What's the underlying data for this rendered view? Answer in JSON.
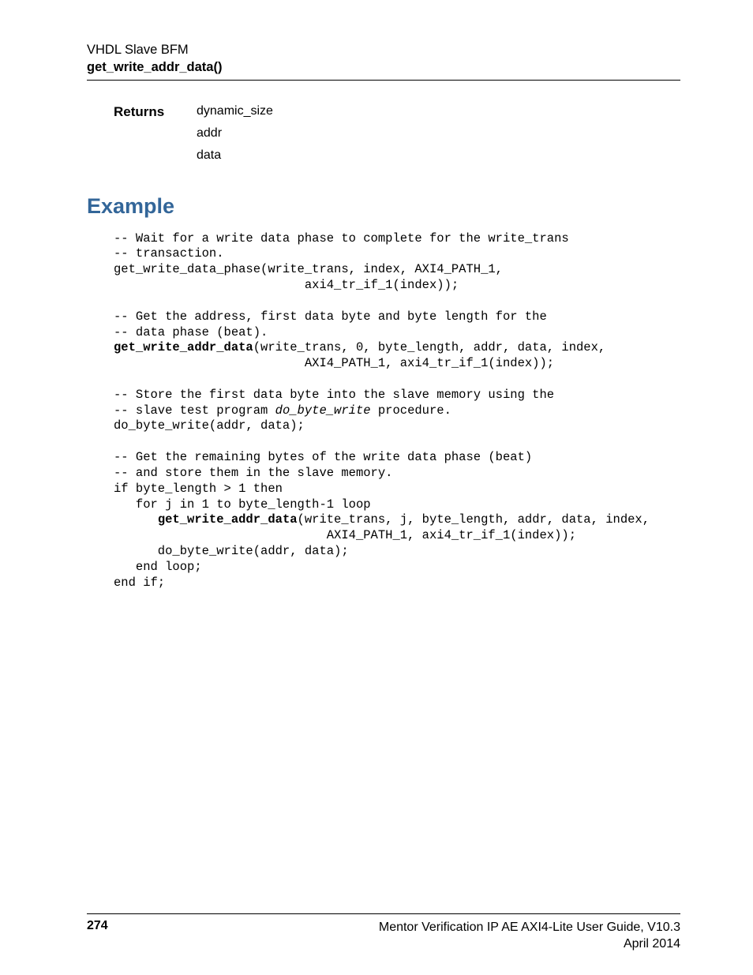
{
  "header": {
    "line1": "VHDL Slave BFM",
    "line2": "get_write_addr_data()"
  },
  "returns": {
    "label": "Returns",
    "values": [
      "dynamic_size",
      "addr",
      "data"
    ]
  },
  "example": {
    "heading": "Example",
    "code_lines": [
      {
        "text": "-- Wait for a write data phase to complete for the write_trans"
      },
      {
        "text": "-- transaction."
      },
      {
        "text": "get_write_data_phase(write_trans, index, AXI4_PATH_1,"
      },
      {
        "text": "                          axi4_tr_if_1(index));"
      },
      {
        "text": ""
      },
      {
        "text": "-- Get the address, first data byte and byte length for the"
      },
      {
        "text": "-- data phase (beat)."
      },
      {
        "bold_prefix": "get_write_addr_data",
        "rest": "(write_trans, 0, byte_length, addr, data, index,"
      },
      {
        "text": "                          AXI4_PATH_1, axi4_tr_if_1(index));"
      },
      {
        "text": ""
      },
      {
        "text": "-- Store the first data byte into the slave memory using the"
      },
      {
        "pre": "-- slave test program ",
        "italic": "do_byte_write",
        "post": " procedure."
      },
      {
        "text": "do_byte_write(addr, data);"
      },
      {
        "text": ""
      },
      {
        "text": "-- Get the remaining bytes of the write data phase (beat)"
      },
      {
        "text": "-- and store them in the slave memory."
      },
      {
        "text": "if byte_length > 1 then"
      },
      {
        "text": "   for j in 1 to byte_length-1 loop"
      },
      {
        "indent": "      ",
        "bold_prefix": "get_write_addr_data",
        "rest": "(write_trans, j, byte_length, addr, data, index,"
      },
      {
        "text": "                             AXI4_PATH_1, axi4_tr_if_1(index));"
      },
      {
        "text": "      do_byte_write(addr, data);"
      },
      {
        "text": "   end loop;"
      },
      {
        "text": "end if;"
      }
    ]
  },
  "footer": {
    "page": "274",
    "right1": "Mentor Verification IP AE AXI4-Lite User Guide, V10.3",
    "right2": "April 2014"
  }
}
